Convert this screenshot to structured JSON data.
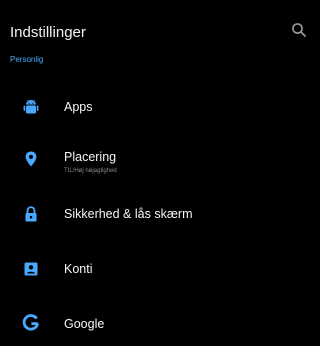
{
  "app_bar": {
    "title": "Indstillinger",
    "search_icon": "search-icon"
  },
  "colors": {
    "background": "#000000",
    "accent": "#4aa8ff",
    "primary_text": "#f5f5f5",
    "secondary_text": "#8a8a8a"
  },
  "section": {
    "header": "Personlig"
  },
  "items": [
    {
      "title": "Apps",
      "icon": "android-icon"
    },
    {
      "title": "Placering",
      "subtitle": "TIL/Høj nøjagtighed",
      "icon": "location-pin-icon"
    },
    {
      "title": "Sikkerhed & lås skærm",
      "icon": "lock-icon"
    },
    {
      "title": "Konti",
      "icon": "account-box-icon"
    },
    {
      "title": "Google",
      "icon": "google-icon"
    }
  ]
}
